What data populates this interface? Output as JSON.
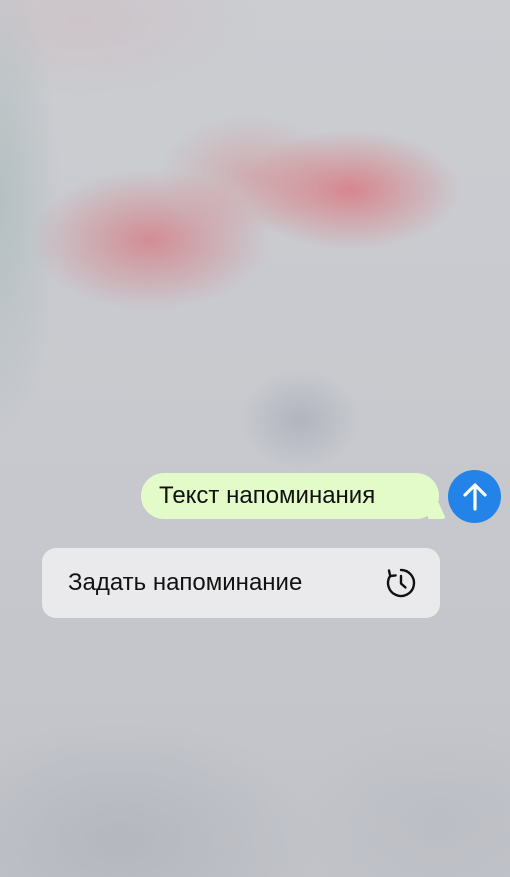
{
  "message": {
    "text": "Текст напоминания"
  },
  "send_button": {
    "icon": "arrow-up-icon",
    "color": "#2383e8"
  },
  "context_menu": {
    "items": [
      {
        "label": "Задать напоминание",
        "icon": "clock-history-icon"
      }
    ]
  },
  "colors": {
    "bubble": "#e3fbc9",
    "menu": "#eaeaec",
    "text": "#111111"
  }
}
